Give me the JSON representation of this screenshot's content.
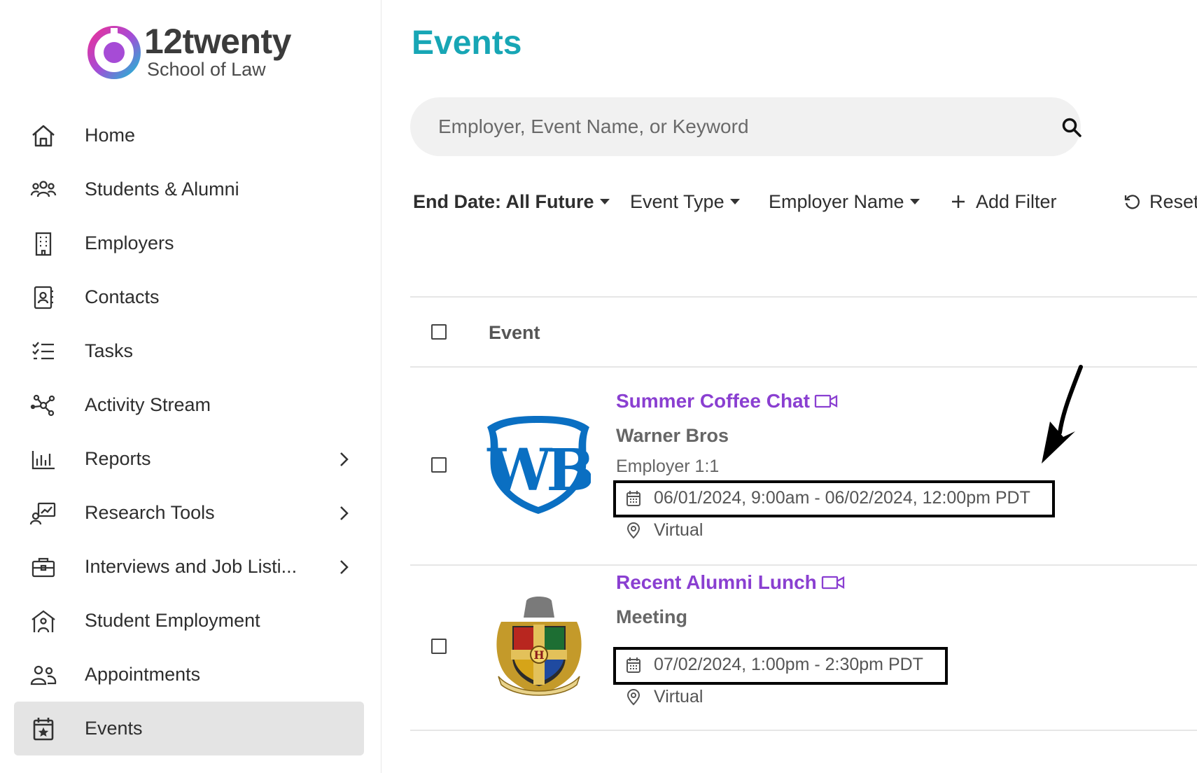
{
  "brand": {
    "title": "12twenty",
    "subtitle": "School of Law"
  },
  "nav": [
    {
      "label": "Home",
      "icon": "home-icon"
    },
    {
      "label": "Students & Alumni",
      "icon": "people-icon"
    },
    {
      "label": "Employers",
      "icon": "building-icon"
    },
    {
      "label": "Contacts",
      "icon": "contact-book-icon"
    },
    {
      "label": "Tasks",
      "icon": "checklist-icon"
    },
    {
      "label": "Activity Stream",
      "icon": "network-icon"
    },
    {
      "label": "Reports",
      "icon": "bar-chart-icon",
      "chevron": true
    },
    {
      "label": "Research Tools",
      "icon": "research-icon",
      "chevron": true
    },
    {
      "label": "Interviews and Job Listi...",
      "icon": "briefcase-icon",
      "chevron": true
    },
    {
      "label": "Student Employment",
      "icon": "student-building-icon"
    },
    {
      "label": "Appointments",
      "icon": "user-pair-icon"
    },
    {
      "label": "Events",
      "icon": "calendar-star-icon",
      "active": true
    }
  ],
  "page": {
    "title": "Events"
  },
  "search": {
    "placeholder": "Employer, Event Name, or Keyword"
  },
  "filters": {
    "end_date": "End Date: All Future",
    "event_type": "Event Type",
    "employer_name": "Employer Name",
    "add_filter": "Add Filter",
    "reset": "Reset"
  },
  "table": {
    "column": "Event"
  },
  "events": [
    {
      "title": "Summer Coffee Chat",
      "employer": "Warner Bros",
      "type": "Employer 1:1",
      "datetime": "06/01/2024, 9:00am - 06/02/2024, 12:00pm PDT",
      "location": "Virtual"
    },
    {
      "title": "Recent Alumni Lunch",
      "employer": "Meeting",
      "datetime": "07/02/2024, 1:00pm - 2:30pm PDT",
      "location": "Virtual"
    }
  ],
  "colors": {
    "accent": "#17a6b5",
    "event_link": "#8a3fd1",
    "active_nav": "#e4e4e4"
  }
}
